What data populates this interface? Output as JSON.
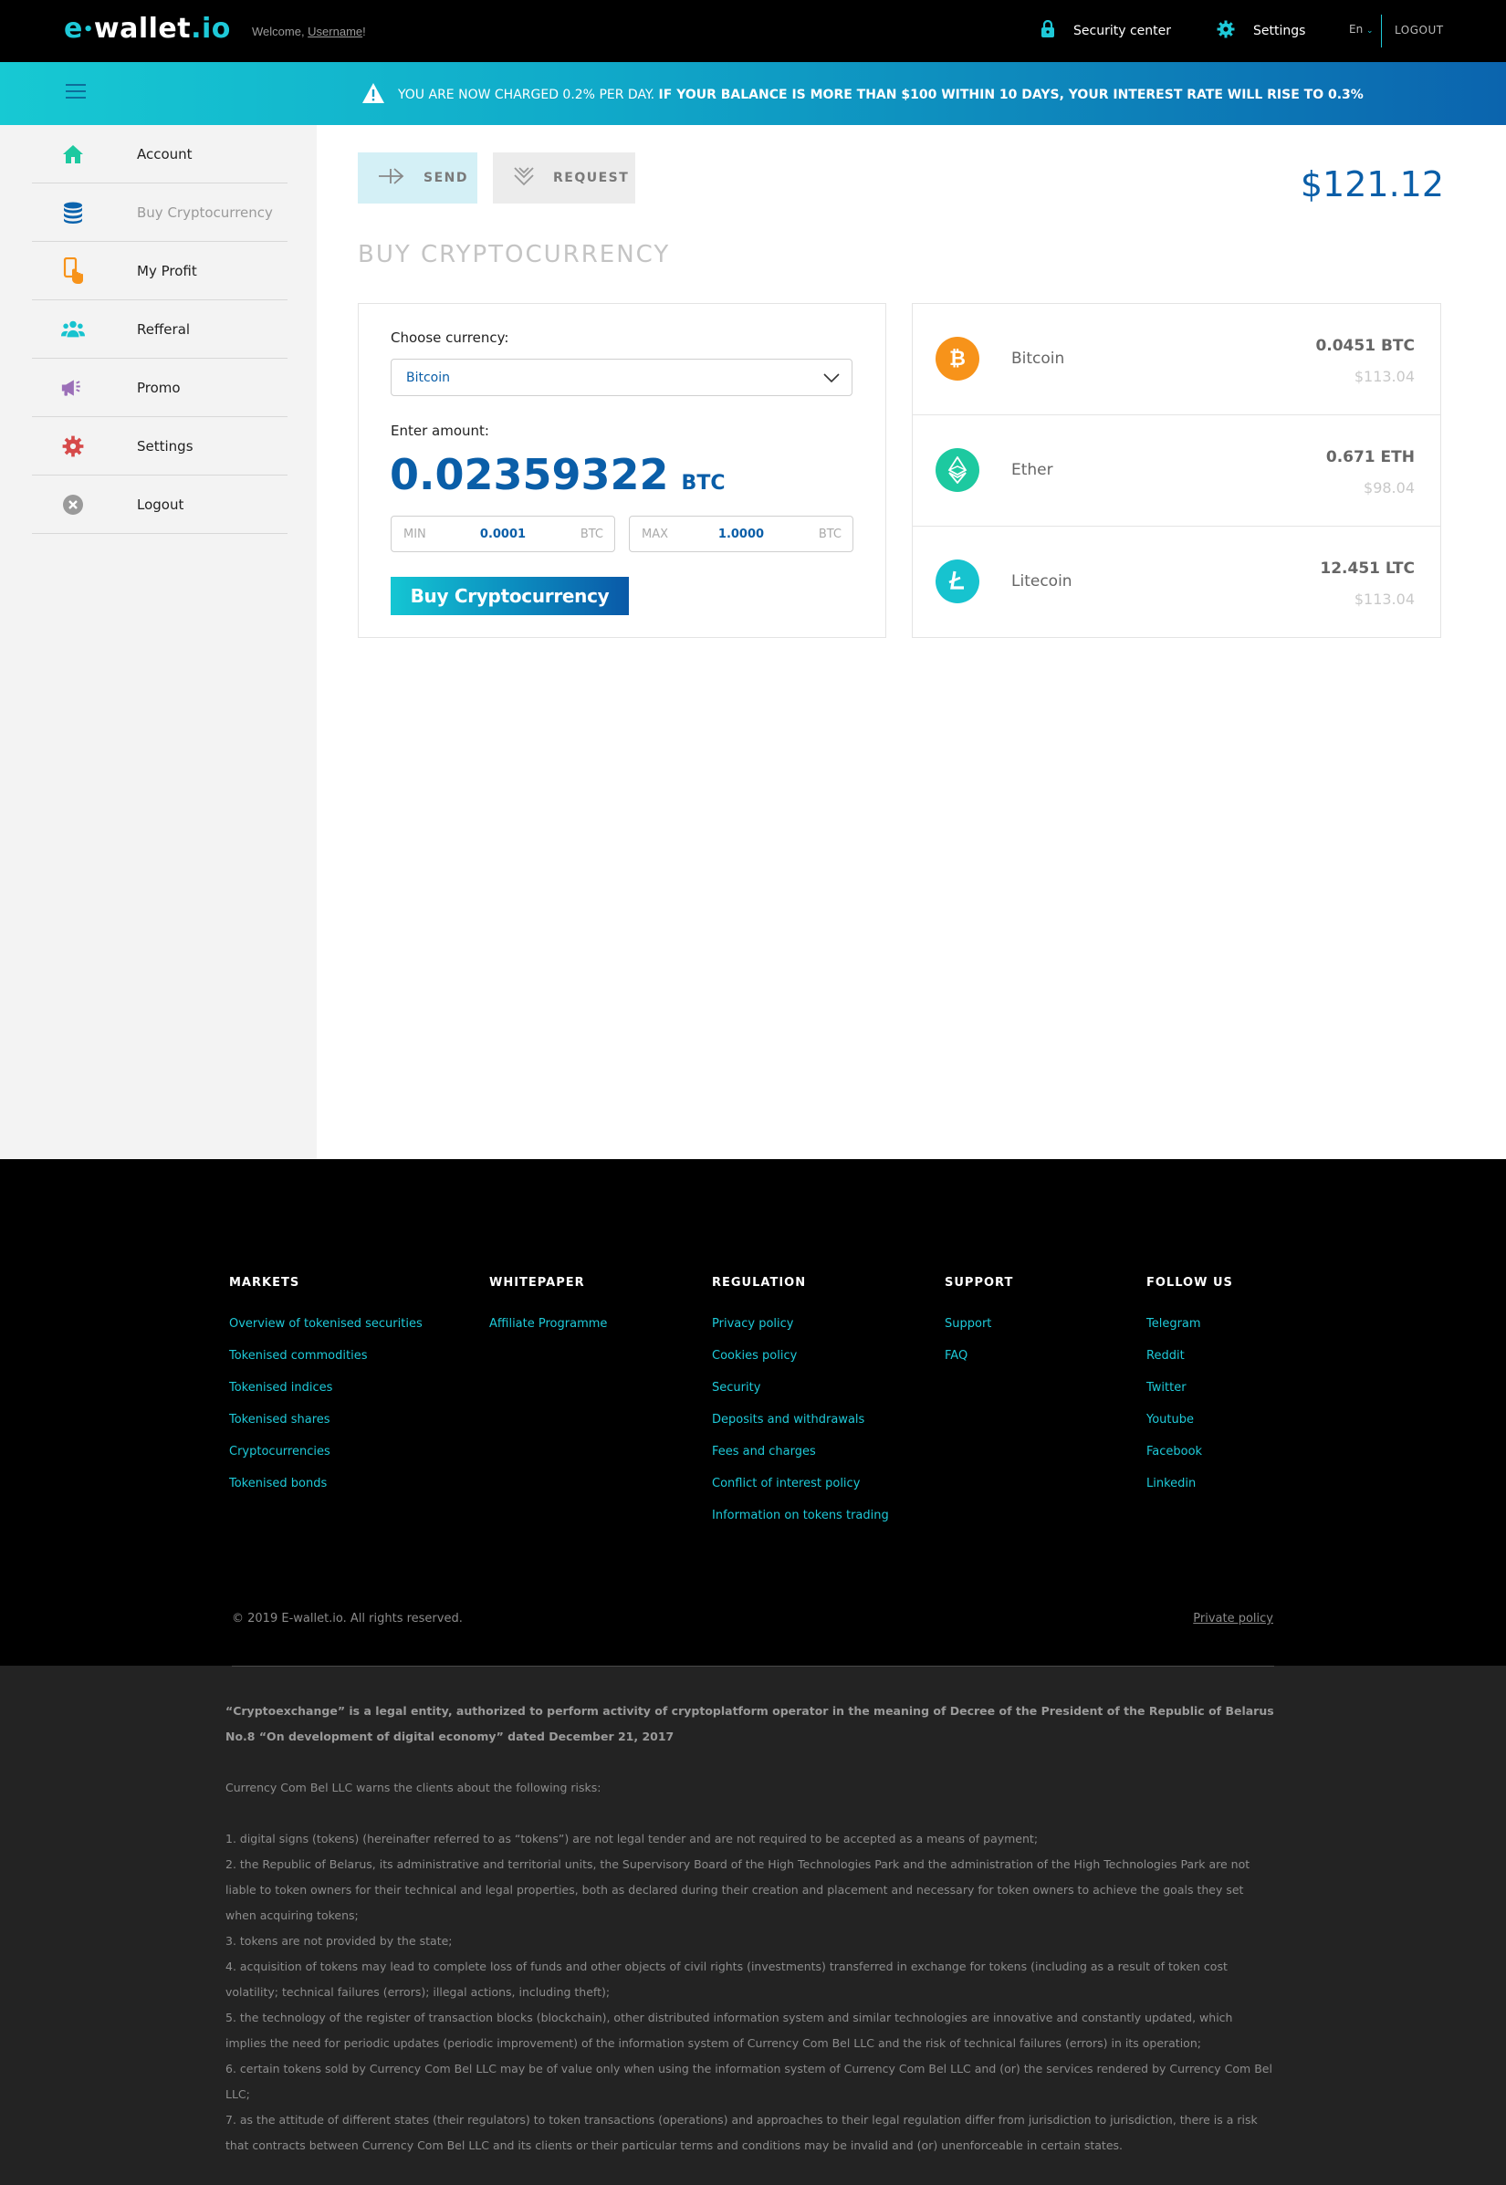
{
  "header": {
    "logo_prefix": "e",
    "logo_dot": "•",
    "logo_main": "wallet",
    "logo_tld": ".io",
    "welcome_text": "Welcome, ",
    "username": "Username",
    "welcome_suffix": "!",
    "security_label": "Security center",
    "settings_label": "Settings",
    "language": "En",
    "logout_label": "LOGOUT"
  },
  "notice": {
    "normal_text": "YOU ARE NOW CHARGED 0.2% PER DAY.",
    "bold_text": "IF YOUR BALANCE IS MORE THAN $100 WITHIN 10 DAYS, YOUR INTEREST RATE WILL RISE TO 0.3%"
  },
  "sidebar": {
    "items": [
      {
        "label": "Account",
        "icon": "home-icon"
      },
      {
        "label": "Buy Cryptocurrency",
        "icon": "coins-icon"
      },
      {
        "label": "My Profit",
        "icon": "phone-hand-icon"
      },
      {
        "label": "Refferal",
        "icon": "users-icon"
      },
      {
        "label": "Promo",
        "icon": "megaphone-icon"
      },
      {
        "label": "Settings",
        "icon": "gear-icon"
      },
      {
        "label": "Logout",
        "icon": "close-circle-icon"
      }
    ]
  },
  "main": {
    "send_label": "SEND",
    "request_label": "REQUEST",
    "balance": "$121.12",
    "title": "BUY CRYPTOCURRENCY",
    "form": {
      "choose_label": "Choose currency:",
      "selected_currency": "Bitcoin",
      "enter_label": "Enter amount:",
      "amount": "0.02359322",
      "amount_unit": "BTC",
      "min_label": "MIN",
      "min_value": "0.0001",
      "min_unit": "BTC",
      "max_label": "MAX",
      "max_value": "1.0000",
      "max_unit": "BTC",
      "buy_label": "Buy Cryptocurrency"
    },
    "wallets": [
      {
        "name": "Bitcoin",
        "amount": "0.0451 BTC",
        "usd": "$113.04",
        "color": "#f7931a",
        "icon": "bitcoin-icon"
      },
      {
        "name": "Ether",
        "amount": "0.671 ETH",
        "usd": "$98.04",
        "color": "#1dc9a0",
        "icon": "ether-icon"
      },
      {
        "name": "Litecoin",
        "amount": "12.451 LTC",
        "usd": "$113.04",
        "color": "#17c3cf",
        "icon": "litecoin-icon"
      }
    ]
  },
  "footer": {
    "columns": [
      {
        "title": "MARKETS",
        "links": [
          "Overview of tokenised securities",
          "Tokenised commodities",
          "Tokenised indices",
          "Tokenised shares",
          "Cryptocurrencies",
          "Tokenised bonds"
        ]
      },
      {
        "title": "WHITEPAPER",
        "links": [
          "Affiliate Programme"
        ]
      },
      {
        "title": "REGULATION",
        "links": [
          "Privacy policy",
          "Cookies policy",
          "Security",
          "Deposits and withdrawals",
          "Fees and charges",
          "Conflict of interest policy",
          "Information on tokens trading"
        ]
      },
      {
        "title": "SUPPORT",
        "links": [
          "Support",
          "FAQ"
        ]
      },
      {
        "title": "FOLLOW US",
        "links": [
          "Telegram",
          "Reddit",
          "Twitter",
          "Youtube",
          "Facebook",
          "Linkedin"
        ]
      }
    ],
    "copyright": "© 2019 E-wallet.io. All rights reserved.",
    "private_policy": "Private policy"
  },
  "legal": {
    "lead": "“Cryptoexchange” is a legal entity, authorized to perform activity of cryptoplatform operator in the meaning of Decree of the President of the Republic of Belarus No.8 “On development of digital economy” dated December 21, 2017",
    "warning": "Currency Com Bel LLC warns the clients about the following risks:",
    "risks": [
      "1. digital signs (tokens) (hereinafter referred to as “tokens”) are not legal tender and are not required to be accepted as a means of payment;",
      "2. the Republic of Belarus, its administrative and territorial units, the Supervisory Board of the High Technologies Park and the administration of the High Technologies Park are not liable to token owners for their technical and legal properties, both as declared during their creation and placement and necessary for token owners to achieve the goals they set when acquiring tokens;",
      "3. tokens are not provided by the state;",
      "4. acquisition of tokens may lead to complete loss of funds and other objects of civil rights (investments) transferred in exchange for tokens (including as a result of token cost volatility; technical failures (errors); illegal actions, including theft);",
      "5. the technology of the register of transaction blocks (blockchain), other distributed information system and similar technologies are innovative and constantly updated, which implies the need for periodic updates (periodic improvement) of the information system of Currency Com Bel LLC and the risk of technical failures (errors) in its operation;",
      "6. certain tokens sold by Currency Com Bel LLC may be of value only when using the information system of Currency Com Bel LLC and (or) the services rendered by Currency Com Bel LLC;",
      "7. as the attitude of different states (their regulators) to token transactions (operations) and approaches to their legal regulation differ from jurisdiction to jurisdiction, there is a risk that contracts between Currency Com Bel LLC and its clients or their particular terms and conditions may be invalid and (or) unenforceable in certain states."
    ]
  }
}
